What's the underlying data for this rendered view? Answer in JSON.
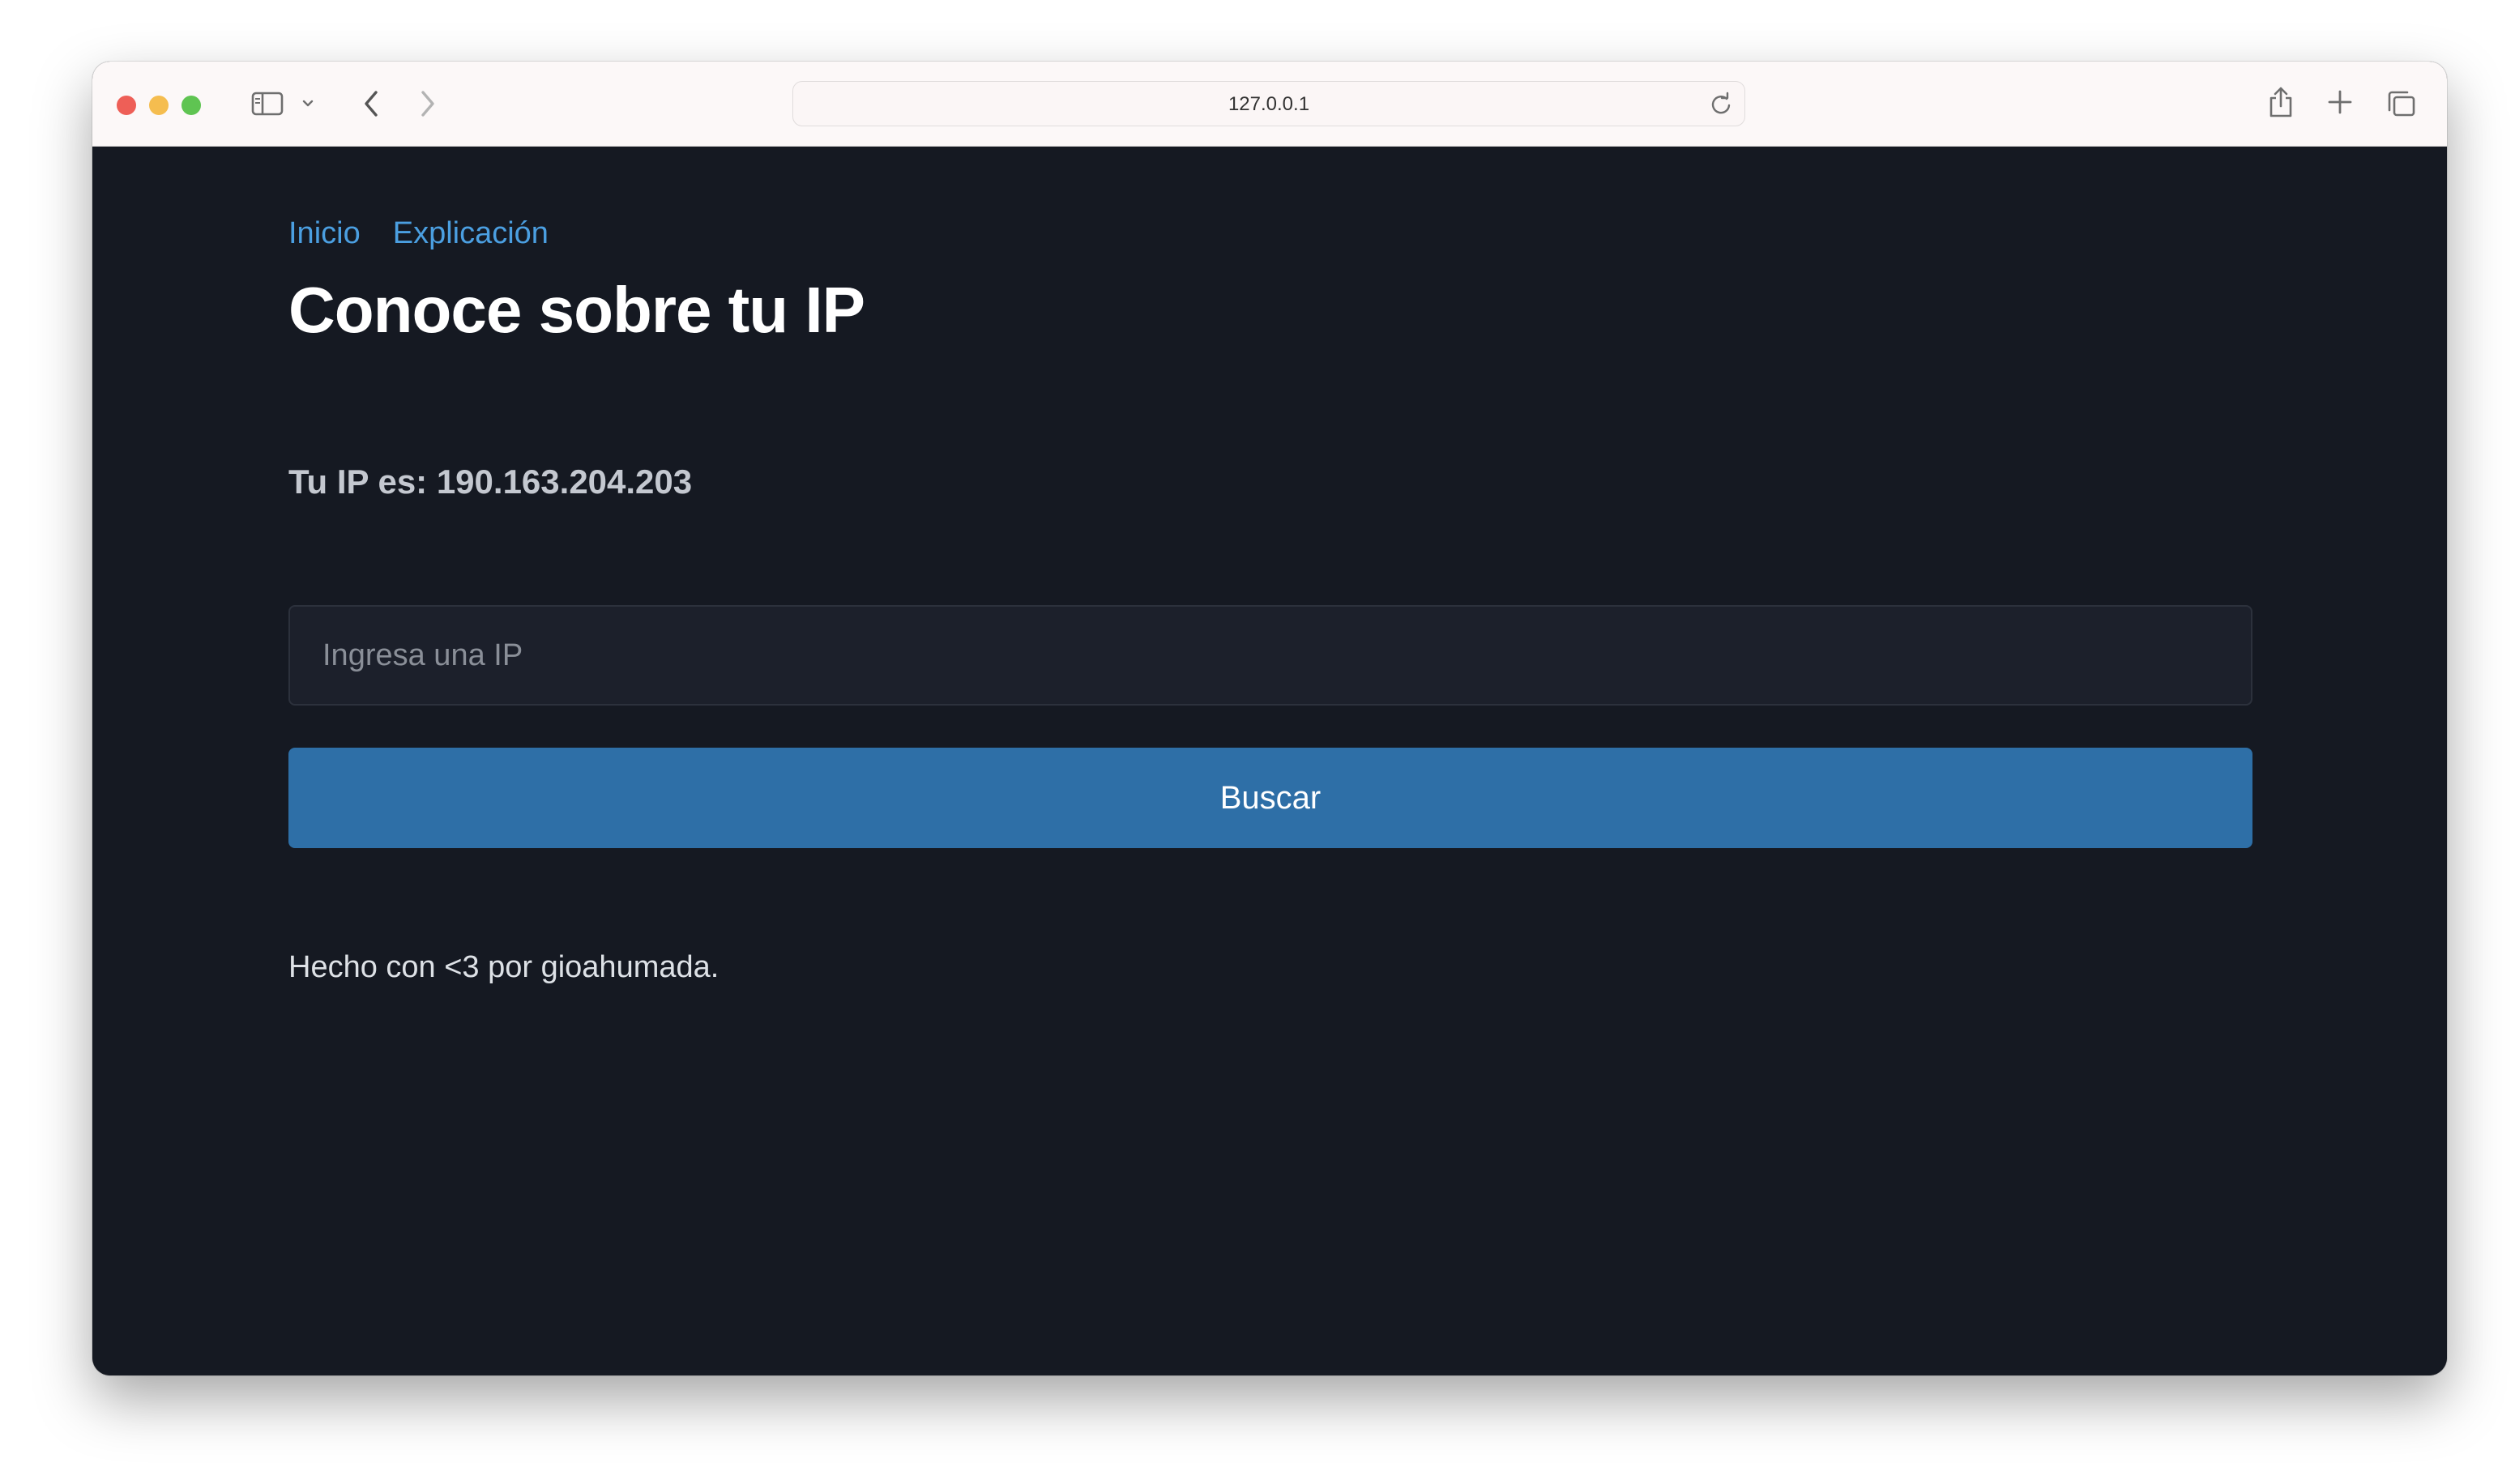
{
  "browser": {
    "url": "127.0.0.1",
    "traffic_lights": {
      "close": "#ee5f57",
      "minimize": "#f5bd4f",
      "zoom": "#5fc452"
    },
    "icons": {
      "sidebar": "sidebar-icon",
      "sidebar_dropdown": "chevron-down-icon",
      "back": "chevron-left-icon",
      "forward": "chevron-right-icon",
      "reload": "reload-icon",
      "share": "share-icon",
      "new_tab": "plus-icon",
      "tabs_overview": "tabs-icon"
    }
  },
  "nav": {
    "items": [
      "Inicio",
      "Explicación"
    ]
  },
  "page": {
    "title": "Conoce sobre tu IP",
    "ip_text": "Tu IP es: 190.163.204.203",
    "input_placeholder": "Ingresa una IP",
    "input_value": "",
    "button_label": "Buscar",
    "footer": "Hecho con <3 por gioahumada."
  },
  "colors": {
    "background": "#151922",
    "link": "#4b9fe1",
    "button": "#2e6fa7",
    "input_bg": "#1c202b"
  }
}
